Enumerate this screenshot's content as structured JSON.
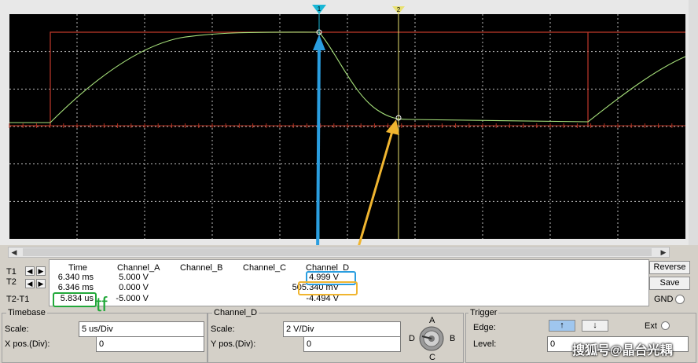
{
  "cursors": {
    "t1_tag": "1",
    "t2_tag": "2"
  },
  "readout": {
    "row_labels": [
      "T1",
      "T2",
      "T2-T1"
    ],
    "headers": [
      "Time",
      "Channel_A",
      "Channel_B",
      "Channel_C",
      "Channel_D"
    ],
    "t1": {
      "time": "6.340 ms",
      "channel_a": "5.000 V",
      "channel_d": "4.999 V"
    },
    "t2": {
      "time": "6.346 ms",
      "channel_a": "0.000 V",
      "channel_d": "505.340 mV"
    },
    "diff": {
      "time": "5.834 us",
      "channel_a": "-5.000 V",
      "channel_d": "-4.494 V"
    },
    "annotation": "tf"
  },
  "buttons": {
    "reverse": "Reverse",
    "save": "Save",
    "gnd": "GND"
  },
  "timebase": {
    "title": "Timebase",
    "scale_label": "Scale:",
    "scale_value": "5 us/Div",
    "xpos_label": "X pos.(Div):",
    "xpos_value": "0"
  },
  "channel_d": {
    "title": "Channel_D",
    "scale_label": "Scale:",
    "scale_value": "2  V/Div",
    "ypos_label": "Y pos.(Div):",
    "ypos_value": "0"
  },
  "selector": {
    "a": "A",
    "b": "B",
    "c": "C",
    "d": "D"
  },
  "trigger": {
    "title": "Trigger",
    "edge_label": "Edge:",
    "level_label": "Level:",
    "level_value": "0",
    "ext_label": "Ext"
  },
  "watermark": "搜狐号@晶台光耦",
  "colors": {
    "channel_a": "#c0392b",
    "channel_d": "#a6e07a",
    "cursor1": "#19b7d6",
    "cursor2": "#e8e070",
    "blue_arrow": "#2a9ee0",
    "yellow_arrow": "#f0b530"
  }
}
